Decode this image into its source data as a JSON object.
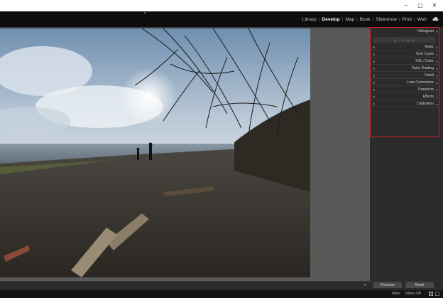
{
  "window": {
    "controls": [
      "–",
      "▢",
      "✕"
    ]
  },
  "modules": {
    "items": [
      "Library",
      "Develop",
      "Map",
      "Book",
      "Slideshow",
      "Print",
      "Web"
    ],
    "active": "Develop",
    "separator": "|"
  },
  "right_panel": {
    "histogram_label": "Histogram",
    "tools": [
      "⊕",
      "◌",
      "⊘",
      "◍",
      "◎"
    ],
    "sections": [
      "Basic",
      "Tone Curve",
      "HSL / Color",
      "Color Grading",
      "Detail",
      "Lens Corrections",
      "Transform",
      "Effects",
      "Calibration"
    ],
    "highlight_color": "#d8202a"
  },
  "bottom": {
    "previous_label": "Previous",
    "reset_label": "Reset",
    "filter_label": "Filter:",
    "filter_value": "Filters Off"
  }
}
